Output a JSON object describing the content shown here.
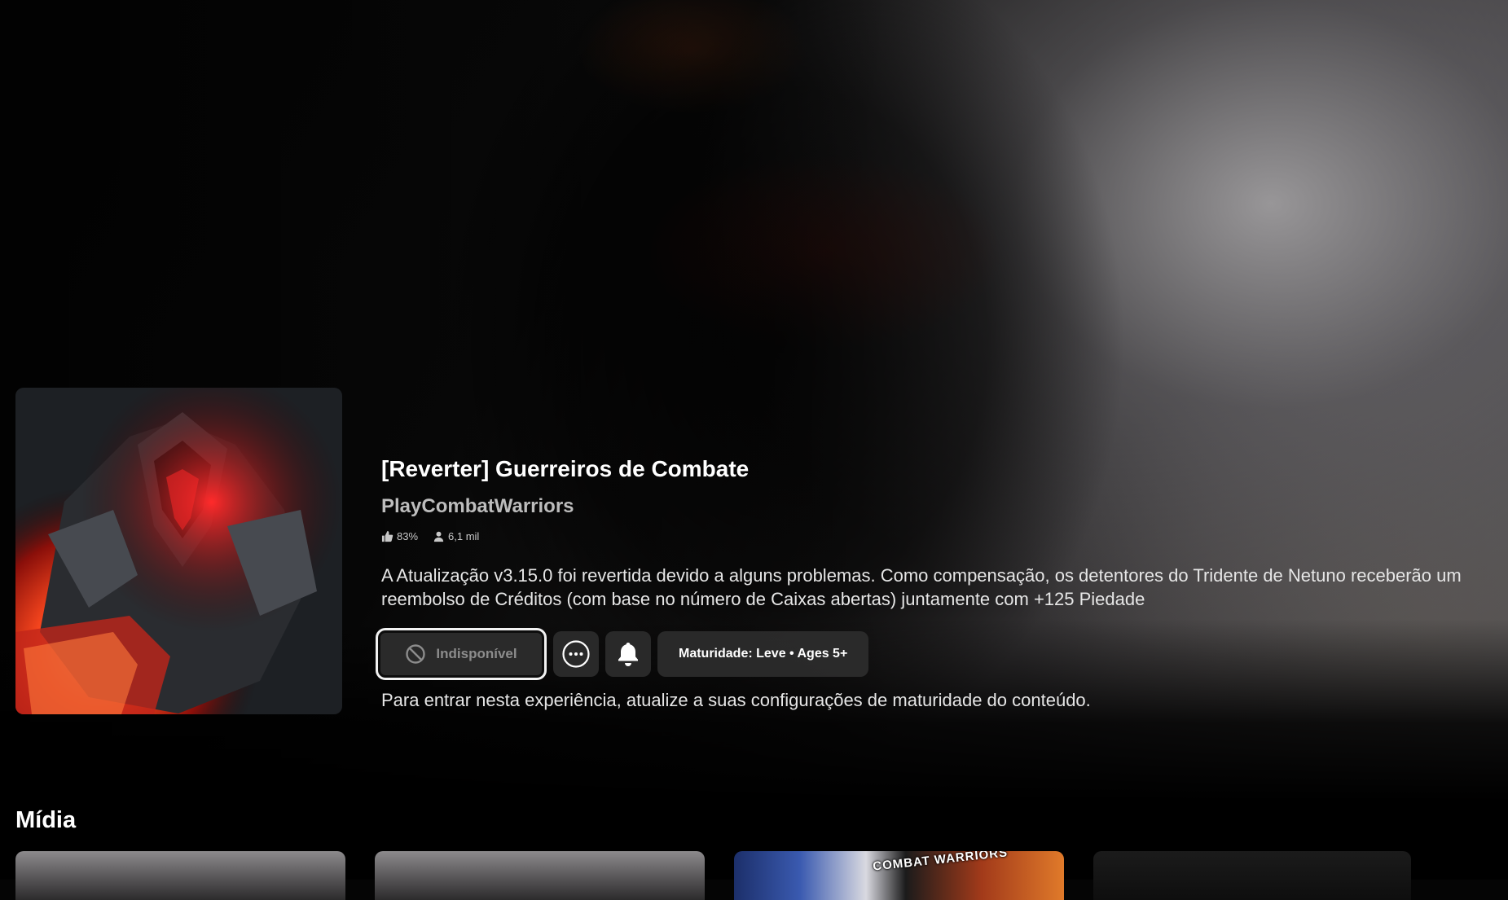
{
  "game": {
    "title": "[Reverter] Guerreiros de Combate",
    "creator": "PlayCombatWarriors",
    "rating": "83%",
    "players": "6,1 mil",
    "description": "A Atualização v3.15.0 foi revertida devido a alguns problemas. Como compensação, os detentores do Tridente de Netuno receberão um reembolso de Créditos (com base no número de Caixas abertas) juntamente com +125 Piedade"
  },
  "actions": {
    "play_label": "Indisponível",
    "more_icon": "more-options-icon",
    "notify_icon": "bell-icon",
    "maturity_label": "Maturidade: Leve • Ages 5+"
  },
  "notice": "Para entrar nesta experiência, atualize a suas configurações de maturidade do conteúdo.",
  "media": {
    "heading": "Mídia",
    "cards": [
      {
        "name": "media-thumbnail-1"
      },
      {
        "name": "media-thumbnail-2"
      },
      {
        "name": "media-thumbnail-3",
        "label": "COMBAT WARRIORS"
      },
      {
        "name": "media-thumbnail-4"
      }
    ]
  },
  "colors": {
    "text_primary": "#ffffff",
    "text_secondary": "#bdbdbd",
    "button_bg": "#2d2d2d",
    "focus_border": "#f2f2f2"
  }
}
